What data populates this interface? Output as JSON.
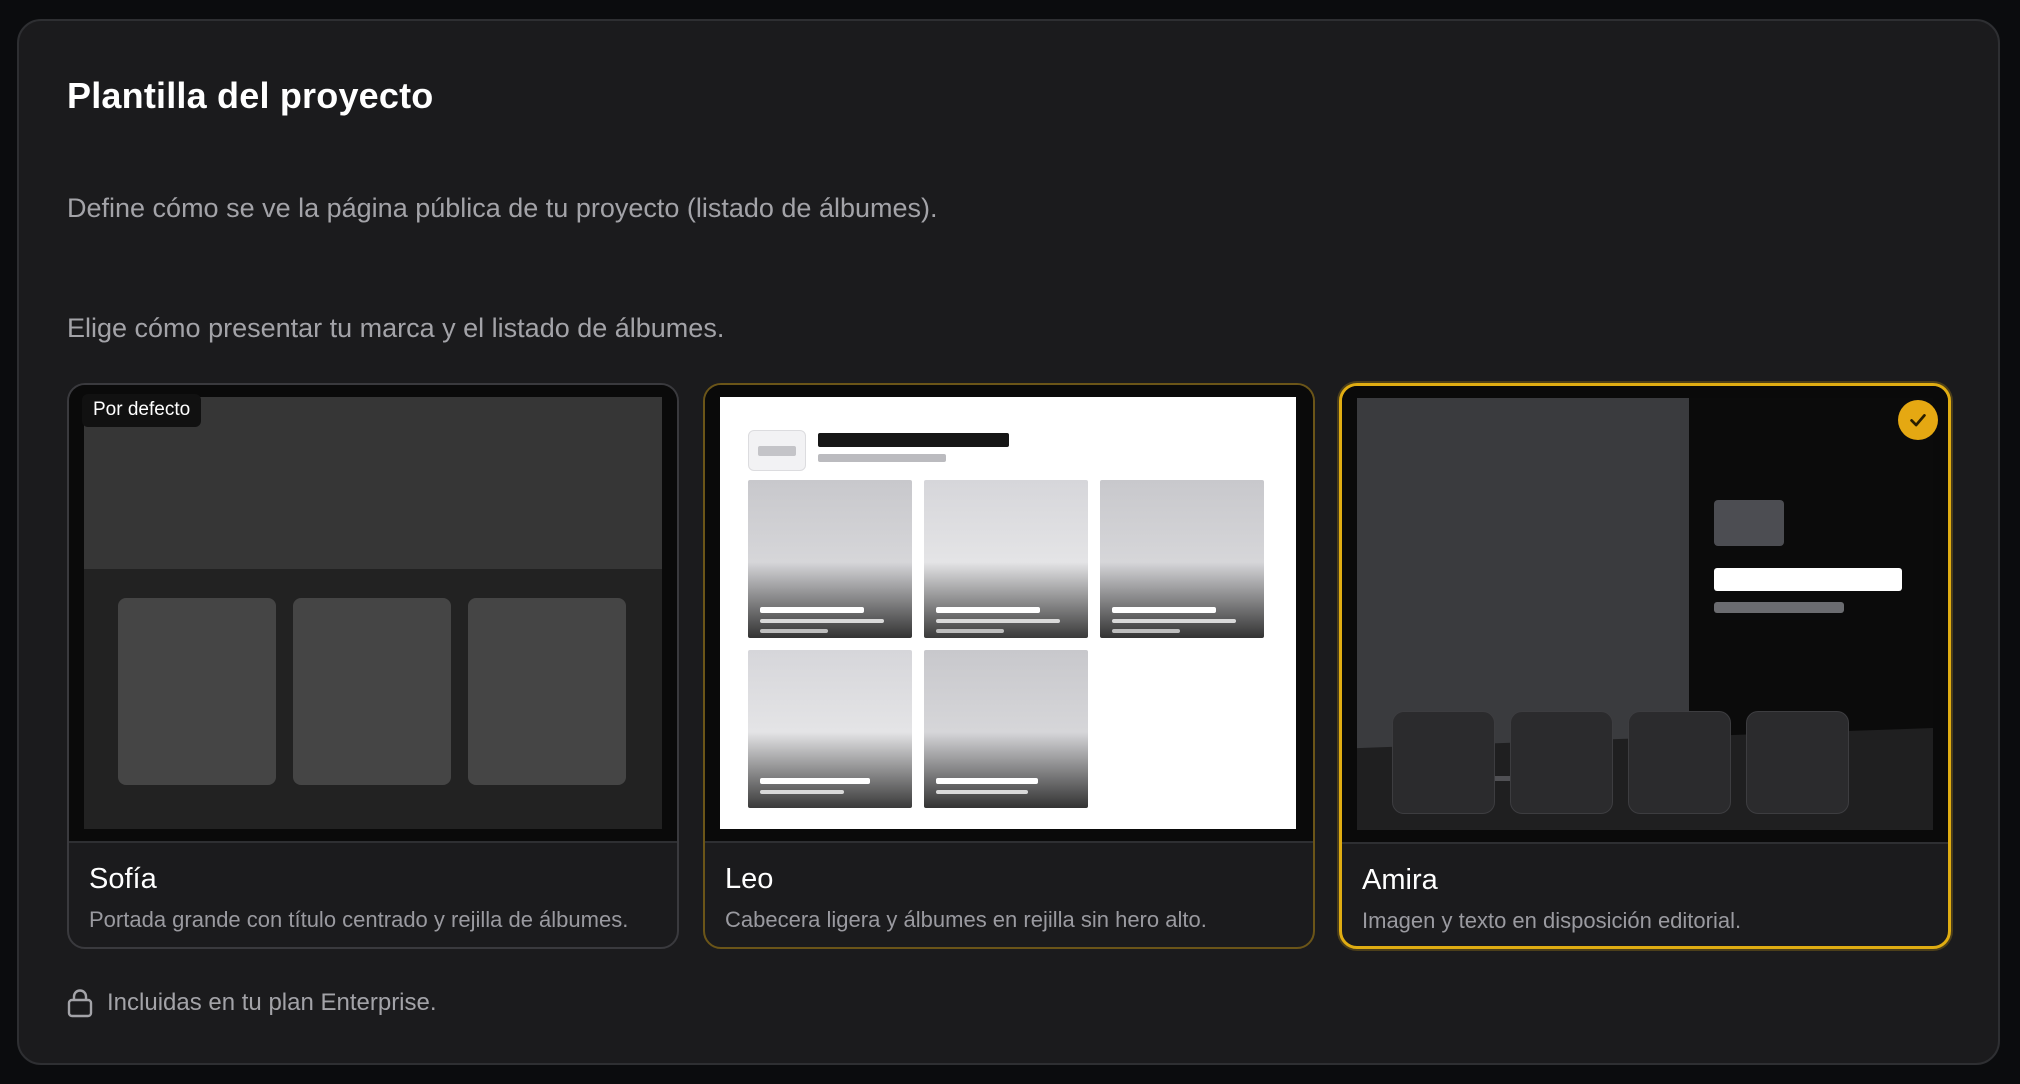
{
  "header": {
    "title": "Plantilla del proyecto",
    "description": "Define cómo se ve la página pública de tu proyecto (listado de álbumes).",
    "subdescription": "Elige cómo presentar tu marca y el listado de álbumes."
  },
  "templates": [
    {
      "name": "Sofía",
      "description": "Portada grande con título centrado y rejilla de álbumes.",
      "badge": "Por defecto",
      "selected": false
    },
    {
      "name": "Leo",
      "description": "Cabecera ligera y álbumes en rejilla sin hero alto.",
      "selected": false
    },
    {
      "name": "Amira",
      "description": "Imagen y texto en disposición editorial.",
      "selected": true
    }
  ],
  "footer": {
    "icon": "lock-icon",
    "text": "Incluidas en tu plan Enterprise."
  },
  "colors": {
    "accent": "#e5a812",
    "panel_bg": "#1b1b1d",
    "page_bg": "#0b0c0e"
  }
}
